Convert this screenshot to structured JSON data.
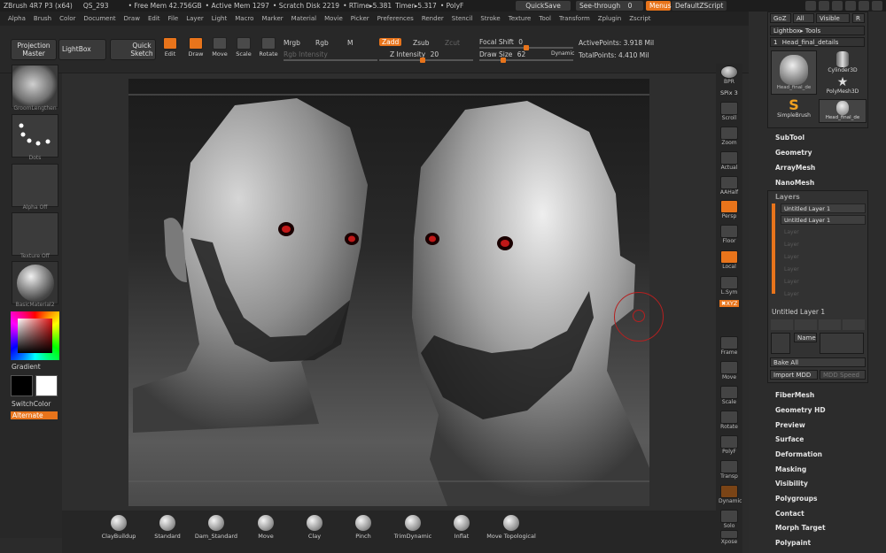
{
  "status": {
    "app": "ZBrush 4R7 P3 (x64)",
    "project": "QS_293",
    "free_mem": "• Free Mem 42.756GB",
    "active_mem": "• Active Mem 1297",
    "scratch": "• Scratch Disk 2219",
    "rtime": "• RTime▸5.381",
    "timer": "Timer▸5.317",
    "polyf": "• PolyF",
    "quicksave": "QuickSave",
    "see_through": "See-through",
    "see_through_val": "0",
    "menus": "Menus",
    "script": "DefaultZScript"
  },
  "menubar": [
    "Alpha",
    "Brush",
    "Color",
    "Document",
    "Draw",
    "Edit",
    "File",
    "Layer",
    "Light",
    "Macro",
    "Marker",
    "Material",
    "Movie",
    "Picker",
    "Preferences",
    "Render",
    "Stencil",
    "Stroke",
    "Texture",
    "Tool",
    "Transform",
    "Zplugin",
    "Zscript"
  ],
  "toolbar": {
    "projection_master": "Projection Master",
    "lightbox": "LightBox",
    "quick_sketch": "Quick Sketch",
    "edit": "Edit",
    "draw": "Draw",
    "move": "Move",
    "scale": "Scale",
    "rotate": "Rotate",
    "mrgb": "Mrgb",
    "rgb": "Rgb",
    "m": "M",
    "zadd": "Zadd",
    "zsub": "Zsub",
    "zcut": "Zcut",
    "rgb_intensity": "Rgb Intensity",
    "z_intensity_label": "Z Intensity",
    "z_intensity_val": "20",
    "focal_shift_label": "Focal Shift",
    "focal_shift_val": "0",
    "draw_size_label": "Draw Size",
    "draw_size_val": "62",
    "dynamic": "Dynamic",
    "active_points": "ActivePoints: 3.918 Mil",
    "total_points": "TotalPoints: 4.410 Mil"
  },
  "leftshelf": {
    "brush": "GroomLengthen",
    "stroke": "Dots",
    "alpha": "Alpha Off",
    "texture": "Texture Off",
    "material": "BasicMaterial2",
    "gradient": "Gradient",
    "switchcolor": "SwitchColor",
    "alternate": "Alternate"
  },
  "rightshelf": {
    "bpr": "BPR",
    "spix": "SPix",
    "spix_val": "3",
    "scroll": "Scroll",
    "zoom": "Zoom",
    "actual": "Actual",
    "aahalf": "AAHalf",
    "persp": "Persp",
    "floor": "Floor",
    "local": "Local",
    "lsym": "L.Sym",
    "xyz": "✖XYZ",
    "frame": "Frame",
    "move": "Move",
    "scale": "Scale",
    "rotate": "Rotate",
    "polyf": "PolyF",
    "transp": "Transp",
    "solo": "Solo",
    "xpose": "Xpose",
    "dynamic": "Dynamic"
  },
  "tray": {
    "goz": "GoZ",
    "all": "All",
    "visible": "Visible",
    "r": "R",
    "lightbox_tools": "Lightbox▸ Tools",
    "current_tool": "Head_final_details",
    "current_tool_count": "1",
    "tools": [
      {
        "label": "Head_final_de",
        "count": "3"
      },
      {
        "label": "Cylinder3D",
        "count": ""
      },
      {
        "label": "PolyMesh3D",
        "count": ""
      },
      {
        "label": "SimpleBrush",
        "count": ""
      },
      {
        "label": "Head_final_de",
        "count": "3"
      }
    ],
    "subtool": "SubTool",
    "geometry": "Geometry",
    "arraymesh": "ArrayMesh",
    "nanomesh": "NanoMesh",
    "layers": "Layers",
    "layer_rows": [
      "Untitled Layer 1",
      "Untitled Layer 1"
    ],
    "empty_layers": [
      "Layer",
      "Layer",
      "Layer",
      "Layer",
      "Layer",
      "Layer",
      "Layer"
    ],
    "current_layer": "Untitled Layer 1",
    "name_btn": "Name",
    "bake_all": "Bake All",
    "import_mdd": "Import MDD",
    "mdd_speed": "MDD Speed",
    "menu_after": [
      "FiberMesh",
      "Geometry HD",
      "Preview",
      "Surface",
      "Deformation",
      "Masking",
      "Visibility",
      "Polygroups",
      "Contact",
      "Morph Target",
      "Polypaint"
    ]
  },
  "brushes": [
    "ClayBuildup",
    "Standard",
    "Dam_Standard",
    "Move",
    "Clay",
    "Pinch",
    "TrimDynamic",
    "Inflat",
    "Move Topological"
  ],
  "colors": {
    "accent": "#e8741b"
  }
}
